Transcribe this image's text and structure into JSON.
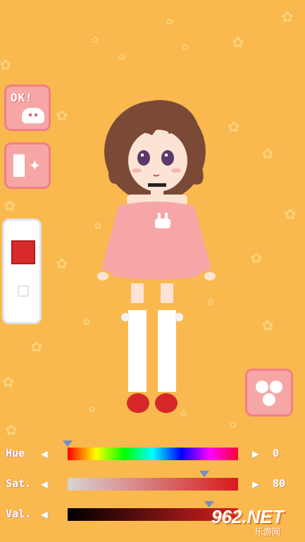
{
  "ok_button": {
    "label": "OK!"
  },
  "color_panel": {
    "selected_color": "#d82a2a"
  },
  "sliders": {
    "hue": {
      "label": "Hue",
      "value": "0",
      "position": 0.0,
      "colors": [
        "#ff0000",
        "#ffff00",
        "#00ff00",
        "#00ffff",
        "#0000ff",
        "#ff00ff"
      ]
    },
    "sat": {
      "label": "Sat.",
      "value": "80",
      "position": 0.8
    },
    "val": {
      "label": "Val.",
      "value": "",
      "position": 0.83
    }
  },
  "watermark": {
    "text": "962.NET",
    "subtext": "乐游网"
  },
  "colors": {
    "background": "#f9b94e",
    "button_pink": "#f7a6a6",
    "button_border": "#f07f86",
    "sweater": "#f6a6a6",
    "hair": "#7a4a36",
    "shoes": "#d62828"
  }
}
